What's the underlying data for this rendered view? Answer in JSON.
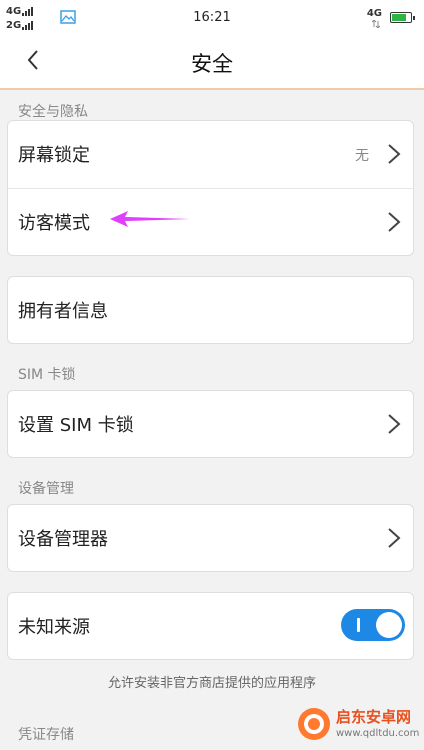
{
  "status_bar": {
    "sim1_net": "4G",
    "sim2_net": "2G",
    "time": "16:21",
    "right_net": "4G",
    "battery_fill_percent": 85,
    "battery_color": "#2fb344"
  },
  "nav": {
    "title": "安全",
    "back_icon": "chevron-left-icon"
  },
  "sections": {
    "security_privacy": {
      "label": "安全与隐私",
      "screen_lock": {
        "label": "屏幕锁定",
        "value": "无"
      },
      "guest_mode": {
        "label": "访客模式"
      }
    },
    "owner_info": {
      "label": "拥有者信息"
    },
    "sim_lock": {
      "label": "SIM 卡锁",
      "set_sim_lock": {
        "label": "设置 SIM 卡锁"
      }
    },
    "device_management": {
      "label": "设备管理",
      "device_admin": {
        "label": "设备管理器"
      }
    },
    "unknown_sources": {
      "label": "未知来源",
      "enabled": true,
      "hint": "允许安装非官方商店提供的应用程序"
    },
    "credential_storage": {
      "label": "凭证存储"
    }
  },
  "annotation": {
    "arrow_color": "#e040fb"
  },
  "watermark": {
    "name": "启东安卓网",
    "url": "www.qdltdu.com"
  },
  "colors": {
    "accent": "#1e88e5",
    "nav_border": "#f4c9a8"
  }
}
